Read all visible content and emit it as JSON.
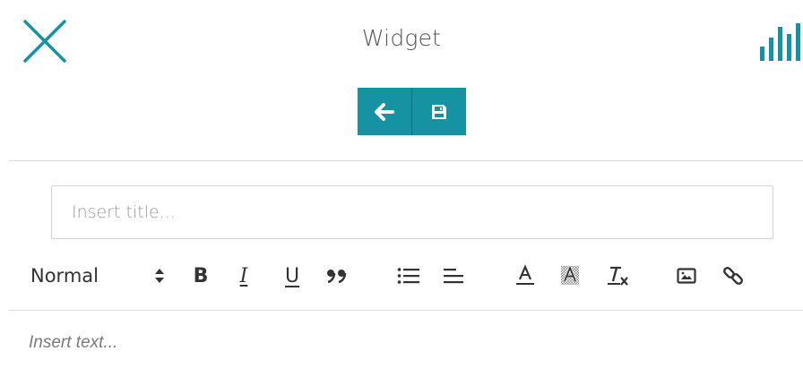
{
  "header": {
    "title": "Widget",
    "close_icon": "close-icon",
    "stats_icon": "bar-chart-icon"
  },
  "actions": {
    "back_icon": "arrow-left-icon",
    "save_icon": "save-icon"
  },
  "form": {
    "title_placeholder": "Insert title...",
    "title_value": ""
  },
  "toolbar": {
    "format_label": "Normal",
    "buttons": [
      "bold-icon",
      "italic-icon",
      "underline-icon",
      "quote-icon",
      "bullet-list-icon",
      "align-icon",
      "text-color-icon",
      "background-color-icon",
      "clear-format-icon",
      "image-icon",
      "link-icon"
    ]
  },
  "editor": {
    "placeholder": "Insert text..."
  },
  "colors": {
    "accent": "#1593a3",
    "divider": "#dcdcdc",
    "text": "#333333"
  }
}
